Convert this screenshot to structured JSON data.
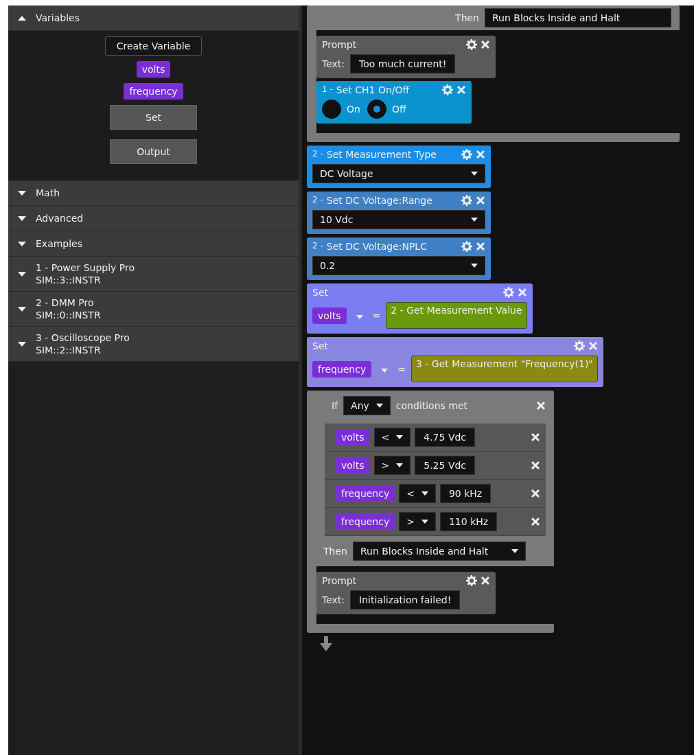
{
  "sidebar": {
    "sections": [
      {
        "label": "Variables",
        "expanded": true,
        "create_button": "Create Variable",
        "variables": [
          "volts",
          "frequency"
        ],
        "blocks": [
          "Set",
          "Output"
        ]
      },
      {
        "label": "Math",
        "expanded": false
      },
      {
        "label": "Advanced",
        "expanded": false
      },
      {
        "label": "Examples",
        "expanded": false
      },
      {
        "label": "1 - Power Supply Pro",
        "address": "SIM::3::INSTR",
        "expanded": false
      },
      {
        "label": "2 - DMM Pro",
        "address": "SIM::0::INSTR",
        "expanded": false
      },
      {
        "label": "3 - Oscilloscope Pro",
        "address": "SIM::2::INSTR",
        "expanded": false
      }
    ]
  },
  "canvas": {
    "blocks": [
      {
        "kind": "if_tail",
        "then_label": "Then",
        "then_action": "Run Blocks Inside and Halt",
        "children": [
          {
            "kind": "prompt",
            "title": "Prompt",
            "label": "Text:",
            "value": "Too much current!"
          },
          {
            "kind": "radio",
            "number": "1 -",
            "title": "Set CH1 On/Off",
            "color": "#0a93cf",
            "options": [
              {
                "label": "On",
                "selected": false
              },
              {
                "label": "Off",
                "selected": true
              }
            ]
          }
        ]
      },
      {
        "kind": "select",
        "number": "2 -",
        "title": "Set Measurement Type",
        "value": "DC Voltage",
        "color": "#1a8ee6"
      },
      {
        "kind": "select",
        "number": "2 -",
        "title": "Set DC Voltage:Range",
        "value": "10 Vdc",
        "color": "#3f80c4"
      },
      {
        "kind": "select",
        "number": "2 -",
        "title": "Set DC Voltage:NPLC",
        "value": "0.2",
        "color": "#3f80c4"
      },
      {
        "kind": "set_variable",
        "title": "Set",
        "variable": "volts",
        "equals": "=",
        "value": {
          "text": "2 - Get Measurement Value",
          "color": "#6a9a0c"
        },
        "color": "#7b7ef0"
      },
      {
        "kind": "set_variable",
        "title": "Set",
        "variable": "frequency",
        "equals": "=",
        "value": {
          "text": "3 - Get Measurement \"Frequency(1)\"",
          "color": "#8a8a10"
        },
        "color": "#8a86e0"
      },
      {
        "kind": "if",
        "if_label": "If",
        "match": "Any",
        "suffix": "conditions met",
        "conditions": [
          {
            "variable": "volts",
            "operator": "<",
            "value": "4.75 Vdc"
          },
          {
            "variable": "volts",
            "operator": ">",
            "value": "5.25 Vdc"
          },
          {
            "variable": "frequency",
            "operator": "<",
            "value": "90 kHz"
          },
          {
            "variable": "frequency",
            "operator": ">",
            "value": "110 kHz"
          }
        ],
        "then_label": "Then",
        "then_action": "Run Blocks Inside and Halt",
        "children": [
          {
            "kind": "prompt",
            "title": "Prompt",
            "label": "Text:",
            "value": "Initialization failed!"
          }
        ]
      }
    ]
  }
}
